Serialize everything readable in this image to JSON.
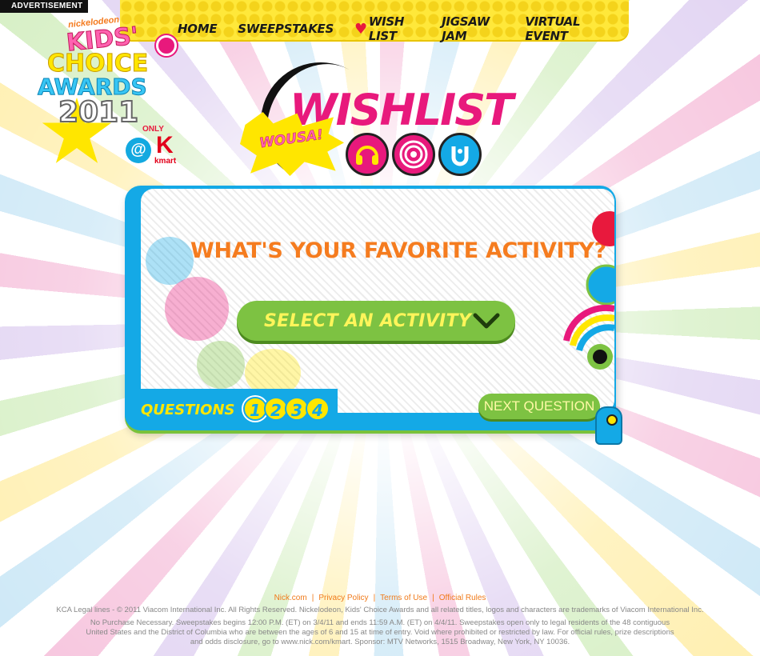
{
  "advertisement": "ADVERTISEMENT",
  "nav": {
    "items": [
      {
        "label": "HOME"
      },
      {
        "label": "SWEEPSTAKES"
      },
      {
        "label": "WISH LIST"
      },
      {
        "label": "JIGSAW JAM"
      },
      {
        "label": "VIRTUAL EVENT"
      }
    ]
  },
  "logo": {
    "brand": "nickelodeon",
    "line1": "KIDS'",
    "line2": "CHOICE",
    "line3": "AWARDS",
    "year": "2011",
    "only_label": "ONLY",
    "at_symbol": "@",
    "kmart_letter": "K",
    "kmart_word": "kmart"
  },
  "wishlist": {
    "title": "WISHLIST",
    "burst_text": "WOUSA!",
    "icons": [
      {
        "name": "headphones-icon",
        "color": "#e8197c"
      },
      {
        "name": "disc-icon",
        "color": "#e8197c"
      },
      {
        "name": "character-icon",
        "color": "#14a9e6"
      }
    ]
  },
  "card": {
    "question": "WHAT'S YOUR FAVORITE ACTIVITY?",
    "select_label": "SELECT AN ACTIVITY",
    "questions_label": "QUESTIONS",
    "question_numbers": [
      "1",
      "2",
      "3",
      "4"
    ],
    "next_label": "NEXT QUESTION"
  },
  "colors": {
    "pink": "#e8197c",
    "orange": "#f57c1f",
    "green": "#7dc242",
    "blue": "#14a9e6",
    "yellow": "#ffe600"
  },
  "footer": {
    "links": [
      "Nick.com",
      "Privacy Policy",
      "Terms of Use",
      "Official Rules"
    ],
    "legal_line": "KCA Legal lines - © 2011 Viacom International Inc. All Rights Reserved. Nickelodeon, Kids' Choice Awards and all related titles, logos and characters are trademarks of Viacom International Inc.",
    "sweepstakes_text": "No Purchase Necessary. Sweepstakes begins 12:00 P.M. (ET) on 3/4/11 and ends 11:59 A.M. (ET) on 4/4/11. Sweepstakes open only to legal residents of the 48 contiguous United States and the District of Columbia who are between the ages of 6 and 15 at time of entry. Void where prohibited or restricted by law. For official rules, prize descriptions and odds disclosure, go to www.nick.com/kmart. Sponsor: MTV Networks, 1515 Broadway, New York, NY 10036."
  }
}
